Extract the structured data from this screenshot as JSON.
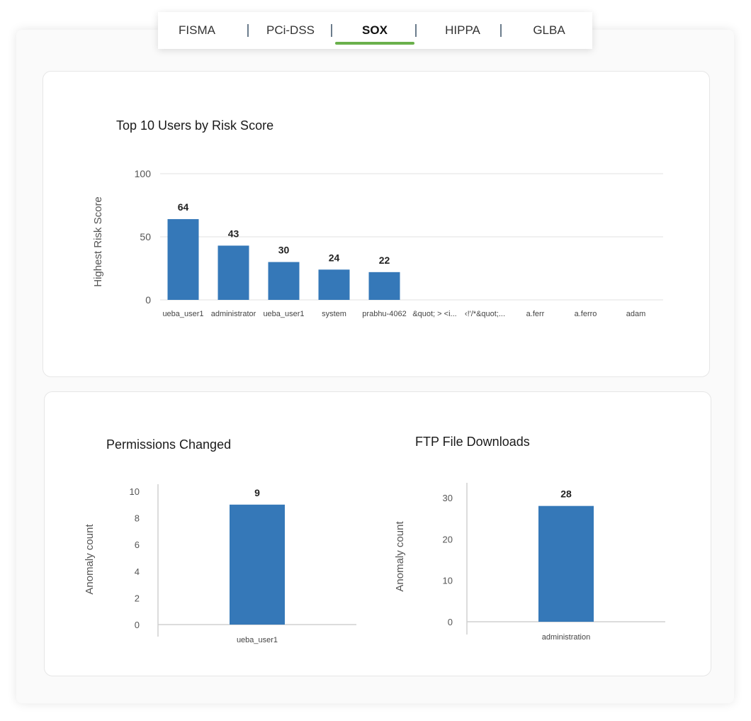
{
  "tabs": [
    {
      "label": "FISMA",
      "active": false
    },
    {
      "label": "PCi-DSS",
      "active": false
    },
    {
      "label": "SOX",
      "active": true
    },
    {
      "label": "HIPPA",
      "active": false
    },
    {
      "label": "GLBA",
      "active": false
    }
  ],
  "colors": {
    "bar": "#3578b8",
    "accent": "#6ab04c",
    "grid": "#e2e2e2"
  },
  "chart_data": [
    {
      "type": "bar",
      "title": "Top 10 Users by Risk Score",
      "xlabel": "",
      "ylabel": "Highest Risk Score",
      "ylim": [
        0,
        100
      ],
      "yticks": [
        "0",
        "50",
        "100"
      ],
      "grid": true,
      "categories": [
        "ueba_user1",
        "administrator",
        "ueba_user1",
        "system",
        "prabhu-4062",
        "&quot; > <i...",
        "‹!'/*&quot;...",
        "a.ferr",
        "a.ferro",
        "adam"
      ],
      "values": [
        64,
        43,
        30,
        24,
        22,
        null,
        null,
        null,
        null,
        null
      ],
      "labels": [
        "64",
        "43",
        "30",
        "24",
        "22",
        "",
        "",
        "",
        "",
        ""
      ]
    },
    {
      "type": "bar",
      "title": "Permissions Changed",
      "xlabel": "",
      "ylabel": "Anomaly count",
      "ylim": [
        0,
        10
      ],
      "yticks": [
        "0",
        "2",
        "4",
        "6",
        "8",
        "10"
      ],
      "grid": false,
      "categories": [
        "ueba_user1"
      ],
      "values": [
        9
      ],
      "labels": [
        "9"
      ]
    },
    {
      "type": "bar",
      "title": "FTP File Downloads",
      "xlabel": "",
      "ylabel": "Anomaly count",
      "ylim": [
        0,
        30
      ],
      "yticks": [
        "0",
        "10",
        "20",
        "30"
      ],
      "grid": false,
      "categories": [
        "administration"
      ],
      "values": [
        28
      ],
      "labels": [
        "28"
      ]
    }
  ]
}
